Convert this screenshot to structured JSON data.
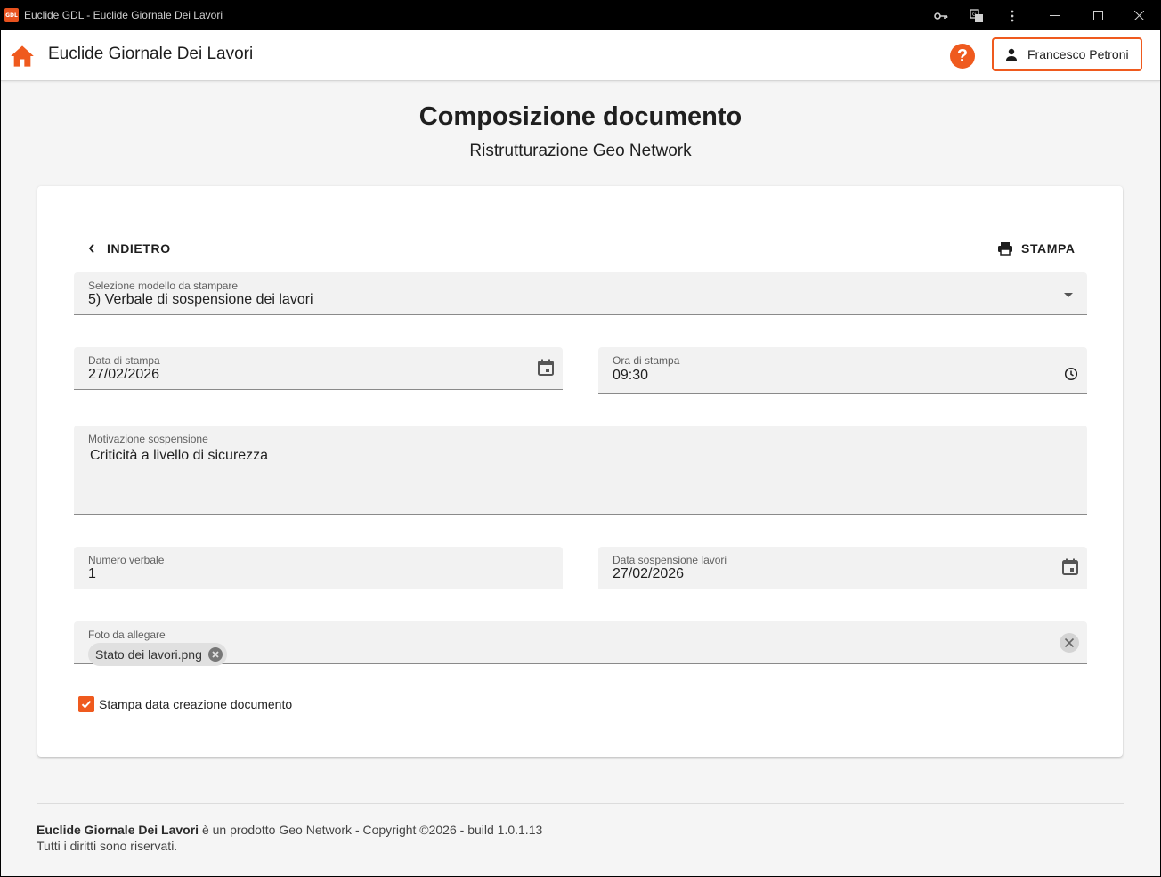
{
  "window": {
    "title": "Euclide GDL - Euclide Giornale Dei Lavori",
    "app_icon_text": "GDL"
  },
  "header": {
    "app_title": "Euclide Giornale Dei Lavori",
    "help_label": "?",
    "user_name": "Francesco Petroni",
    "accent_color": "#ef5a1e"
  },
  "page": {
    "title": "Composizione documento",
    "subtitle": "Ristrutturazione Geo Network"
  },
  "card": {
    "back_label": "INDIETRO",
    "print_label": "STAMPA",
    "template_select": {
      "label": "Selezione modello da stampare",
      "value": "5) Verbale di sospensione dei lavori"
    },
    "print_date": {
      "label": "Data di stampa",
      "value": "27/02/2026"
    },
    "print_time": {
      "label": "Ora di stampa",
      "value": "09:30"
    },
    "suspension_reason": {
      "label": "Motivazione sospensione",
      "value": "Criticità a livello di sicurezza"
    },
    "report_number": {
      "label": "Numero verbale",
      "value": "1"
    },
    "suspension_date": {
      "label": "Data sospensione lavori",
      "value": "27/02/2026"
    },
    "photos": {
      "label": "Foto da allegare",
      "chips": [
        "Stato dei lavori.png"
      ]
    },
    "print_creation_date": {
      "label": "Stampa data creazione documento",
      "checked": true
    }
  },
  "footer": {
    "product_name": "Euclide Giornale Dei Lavori",
    "line1_rest": " è un prodotto Geo Network - Copyright ©2026 - build 1.0.1.13",
    "line2": "Tutti i diritti sono riservati."
  }
}
